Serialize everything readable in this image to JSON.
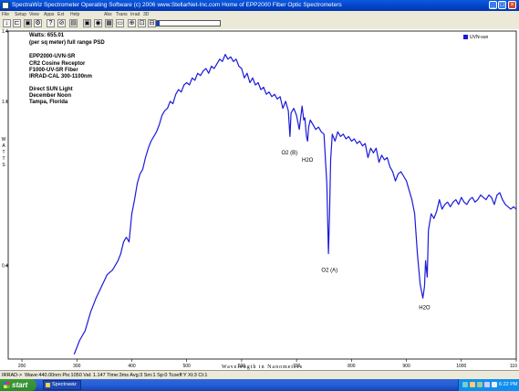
{
  "window": {
    "title": "SpectraWiz  Spectrometer Operating Software (c) 2006  www.StellarNet-Inc.com  Home of EPP2000 Fiber Optic Spectrometers",
    "controls": {
      "minimize": "_",
      "maximize": "□",
      "close": "×"
    }
  },
  "menu": [
    "File",
    "Setup",
    "View",
    "Apps",
    "Ext",
    "Help",
    "",
    "",
    "",
    "",
    "",
    "",
    "",
    "Abs",
    "Trans",
    "Irrad",
    "3D"
  ],
  "toolbar": {
    "buttons": [
      "↓",
      "⊏",
      "▣",
      "⚙",
      "?",
      "⊘",
      "▤",
      "▣",
      "◉",
      "▦",
      "▭",
      "⊕",
      "⊡",
      "⊟"
    ],
    "progress_fraction": 0.06
  },
  "chart_info": {
    "watts": "Watts: 655.01",
    "unit": "(per sq meter) full range PSD",
    "lines": [
      "EPP2000-UVN-SR",
      "CR2 Cosine Receptor",
      "F1000-UV-SR Fiber",
      "IRRAD-CAL 300-1100nm"
    ],
    "lines2": [
      "Direct SUN Light",
      "December Noon",
      "Tampa, Florida"
    ]
  },
  "chart_data": {
    "type": "line",
    "title": "",
    "xlabel": "Wavelength in Nanometers",
    "ylabel": "WATTS",
    "xlim": [
      175,
      1100
    ],
    "ylim": [
      0,
      1.4
    ],
    "x_ticks": [
      200,
      300,
      400,
      500,
      600,
      700,
      800,
      900,
      1000,
      1100
    ],
    "x_tick_labels": [
      "200",
      "300",
      "400",
      "500",
      "600",
      "700",
      "800",
      "900",
      "1000",
      "110"
    ],
    "y_ticks": [
      1.4,
      1.1,
      0.4
    ],
    "y_tick_labels": [
      "1.4",
      "1.1",
      "0.4"
    ],
    "grid": false,
    "legend_position": "top-right",
    "series": [
      {
        "name": "UVN-sun",
        "color": "#1a1adb",
        "x": [
          295,
          305,
          315,
          325,
          335,
          345,
          355,
          365,
          375,
          380,
          385,
          390,
          395,
          400,
          405,
          410,
          415,
          420,
          425,
          430,
          435,
          440,
          445,
          450,
          455,
          460,
          465,
          470,
          475,
          480,
          485,
          490,
          495,
          500,
          505,
          510,
          515,
          520,
          525,
          530,
          535,
          540,
          545,
          550,
          555,
          560,
          565,
          570,
          575,
          580,
          585,
          590,
          595,
          600,
          605,
          610,
          615,
          620,
          625,
          630,
          635,
          640,
          645,
          650,
          655,
          660,
          665,
          670,
          675,
          680,
          685,
          688,
          690,
          695,
          700,
          705,
          710,
          713,
          715,
          718,
          720,
          722,
          725,
          730,
          735,
          740,
          745,
          750,
          755,
          758,
          760,
          762,
          765,
          770,
          775,
          780,
          785,
          790,
          795,
          800,
          805,
          810,
          815,
          820,
          825,
          830,
          835,
          840,
          845,
          850,
          855,
          860,
          865,
          870,
          875,
          880,
          885,
          890,
          895,
          900,
          905,
          910,
          915,
          920,
          925,
          930,
          933,
          935,
          938,
          940,
          945,
          950,
          955,
          960,
          965,
          970,
          975,
          980,
          985,
          990,
          995,
          1000,
          1005,
          1010,
          1015,
          1020,
          1025,
          1030,
          1035,
          1040,
          1045,
          1050,
          1055,
          1060,
          1065,
          1070,
          1075,
          1080,
          1085,
          1090,
          1095,
          1100
        ],
        "values": [
          0.02,
          0.08,
          0.12,
          0.2,
          0.26,
          0.31,
          0.36,
          0.38,
          0.42,
          0.45,
          0.5,
          0.52,
          0.5,
          0.62,
          0.68,
          0.75,
          0.79,
          0.81,
          0.86,
          0.9,
          0.93,
          0.95,
          0.97,
          1.0,
          1.04,
          1.06,
          1.07,
          1.1,
          1.09,
          1.13,
          1.15,
          1.14,
          1.17,
          1.18,
          1.17,
          1.2,
          1.19,
          1.22,
          1.21,
          1.23,
          1.24,
          1.22,
          1.25,
          1.24,
          1.26,
          1.28,
          1.27,
          1.3,
          1.28,
          1.29,
          1.27,
          1.28,
          1.25,
          1.24,
          1.2,
          1.22,
          1.18,
          1.2,
          1.17,
          1.18,
          1.15,
          1.16,
          1.13,
          1.14,
          1.12,
          1.13,
          1.11,
          1.12,
          1.07,
          1.1,
          1.06,
          0.95,
          1.05,
          1.07,
          1.04,
          0.98,
          1.08,
          1.02,
          1.03,
          0.95,
          0.93,
          0.99,
          1.02,
          1.0,
          0.98,
          0.99,
          0.97,
          0.96,
          0.75,
          0.45,
          0.62,
          0.85,
          0.96,
          0.93,
          0.97,
          0.95,
          0.96,
          0.94,
          0.95,
          0.93,
          0.94,
          0.92,
          0.93,
          0.91,
          0.92,
          0.86,
          0.9,
          0.88,
          0.9,
          0.84,
          0.87,
          0.85,
          0.86,
          0.82,
          0.8,
          0.76,
          0.79,
          0.8,
          0.78,
          0.76,
          0.72,
          0.68,
          0.62,
          0.45,
          0.32,
          0.26,
          0.31,
          0.42,
          0.35,
          0.55,
          0.62,
          0.6,
          0.63,
          0.68,
          0.64,
          0.66,
          0.67,
          0.65,
          0.67,
          0.68,
          0.66,
          0.69,
          0.67,
          0.66,
          0.68,
          0.69,
          0.67,
          0.68,
          0.7,
          0.69,
          0.68,
          0.7,
          0.69,
          0.66,
          0.7,
          0.71,
          0.68,
          0.66,
          0.65,
          0.64,
          0.65,
          0.64
        ]
      }
    ],
    "annotations": [
      {
        "text": "O2 (B)",
        "x": 687,
        "y": 0.9
      },
      {
        "text": "H2O",
        "x": 720,
        "y": 0.87
      },
      {
        "text": "O2 (A)",
        "x": 760,
        "y": 0.4
      },
      {
        "text": "H2O",
        "x": 933,
        "y": 0.24
      }
    ]
  },
  "statusbar": {
    "mode": "IRRAD->",
    "text": "Wave:440.00nm  Pix:1050  Val:  1.147  Time:3ms  Avg:3  Sm:1  Sp:0  Tcoeff:Y  Xt:3  Ct:1"
  },
  "taskbar": {
    "start_label": "start",
    "task_label": "Spectrawiz",
    "clock": "6:22 PM"
  },
  "colors": {
    "titlebar": "#0242c8",
    "series": "#1a1adb",
    "taskbar": "#245edb",
    "start": "#3c9a3c"
  }
}
